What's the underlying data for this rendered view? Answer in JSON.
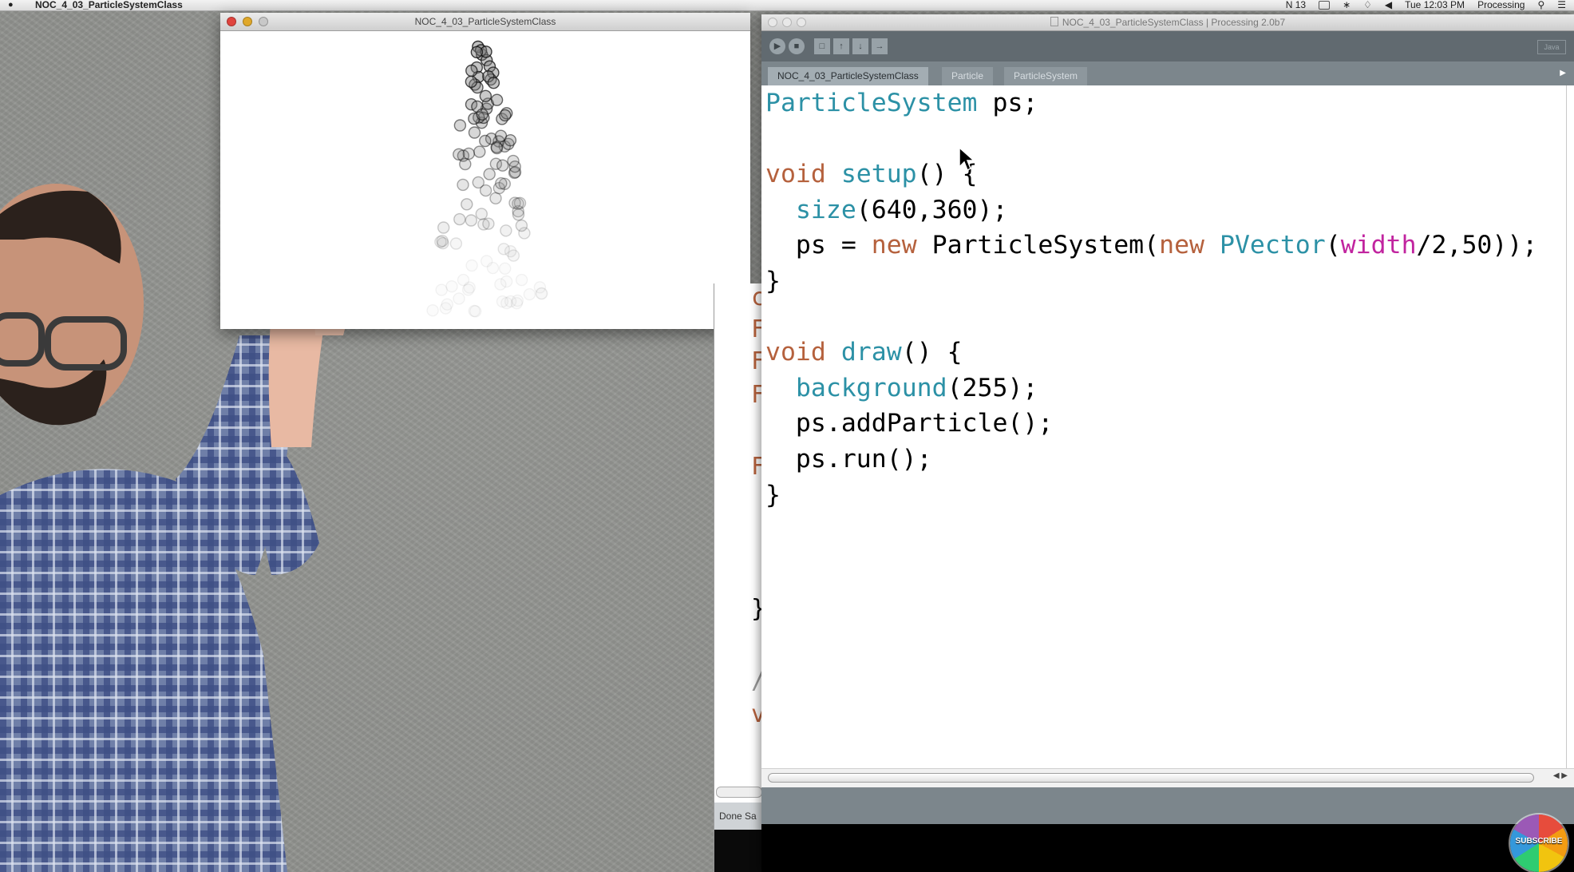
{
  "menubar": {
    "app_title": "NOC_4_03_ParticleSystemClass",
    "status_items": [
      "N 13",
      "Tue 12:03 PM",
      "Processing"
    ]
  },
  "sketch_window": {
    "title": "NOC_4_03_ParticleSystemClass"
  },
  "ide": {
    "title": "NOC_4_03_ParticleSystemClass | Processing 2.0b7",
    "mode": "Java",
    "tabs": [
      {
        "label": "NOC_4_03_ParticleSystemClass",
        "active": true
      },
      {
        "label": "Particle",
        "active": false
      },
      {
        "label": "ParticleSystem",
        "active": false
      }
    ],
    "toolbar": {
      "run": "run",
      "stop": "stop",
      "new": "new",
      "open": "open",
      "save": "save",
      "export": "export"
    },
    "code_lines": [
      "ParticleSystem ps;",
      "",
      "void setup() {",
      "  size(640,360);",
      "  ps = new ParticleSystem(new PVector(width/2,50));",
      "}",
      "",
      "void draw() {",
      "  background(255);",
      "  ps.addParticle();",
      "  ps.run();",
      "}"
    ]
  },
  "background_editor": {
    "status_text": "Done Sa",
    "visible_chars": [
      "c",
      "F",
      "F",
      "F",
      "F",
      "}",
      "/",
      "v"
    ]
  },
  "subscribe_label": "SUBSCRIBE",
  "colors": {
    "keyword": "#b5613d",
    "function": "#2c91a6",
    "builtin_var": "#c1249f",
    "toolbar": "#616a70",
    "tabbar": "#7c868c"
  },
  "icons": {
    "run": "play-icon",
    "stop": "stop-icon",
    "new": "new-file-icon",
    "open": "open-icon",
    "save": "save-icon",
    "export": "export-icon"
  }
}
